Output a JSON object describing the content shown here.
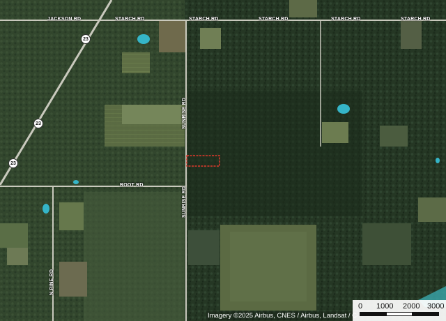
{
  "map": {
    "road_labels": {
      "jackson": "JACKSON RD",
      "starch_1": "STARCH RD",
      "starch_2": "STARCH RD",
      "starch_3": "STARCH RD",
      "starch_4": "STARCH RD",
      "starch_5": "STARCH RD",
      "sunrise_1": "SUNRISE RD",
      "sunrise_2": "SUNRISE RD",
      "root": "ROOT RD",
      "n_pine": "N PINE RD"
    },
    "route_shields": [
      "23",
      "23",
      "23"
    ],
    "attribution": "Imagery ©2025 Airbus, CNES / Airbus, Landsat / Copernicus",
    "scale": {
      "labels": [
        "0",
        "1000",
        "2000",
        "3000"
      ]
    },
    "colors": {
      "forest_dark": "#243523",
      "field": "#6b7a4e",
      "water": "#35b5c8",
      "parcel_outline": "#e0392b",
      "road": "#c9c9bd"
    }
  }
}
